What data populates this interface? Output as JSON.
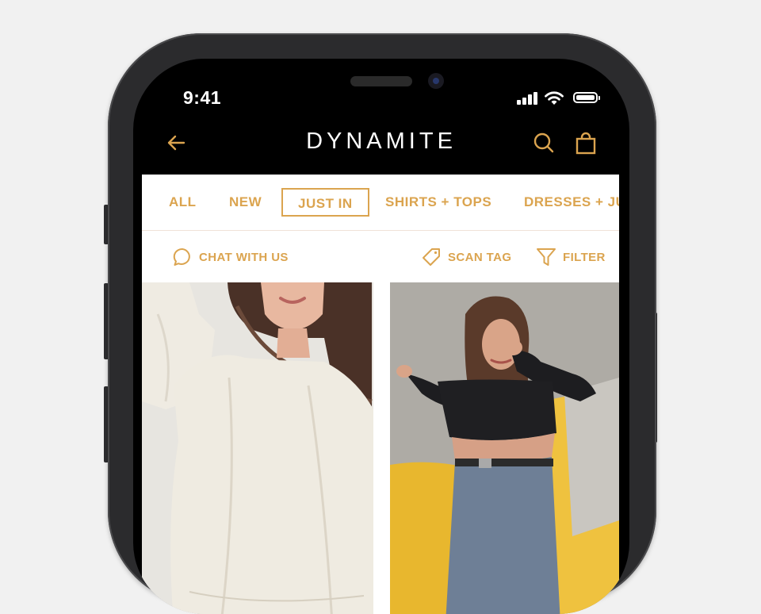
{
  "status_bar": {
    "time": "9:41"
  },
  "header": {
    "brand": "DYNAMITE",
    "back_icon": "arrow-left-icon",
    "search_icon": "search-icon",
    "bag_icon": "shopping-bag-icon"
  },
  "tabs": [
    {
      "label": "ALL",
      "active": false
    },
    {
      "label": "NEW",
      "active": false
    },
    {
      "label": "JUST IN",
      "active": true
    },
    {
      "label": "SHIRTS + TOPS",
      "active": false
    },
    {
      "label": "DRESSES + JU",
      "active": false
    }
  ],
  "toolbar": {
    "chat": {
      "label": "CHAT WITH US",
      "icon": "chat-bubble-icon"
    },
    "scan": {
      "label": "SCAN TAG",
      "icon": "tag-icon"
    },
    "filter": {
      "label": "FILTER",
      "icon": "filter-icon"
    }
  },
  "products": [
    {
      "image": "woman-in-cream-blouse"
    },
    {
      "image": "woman-in-black-crop-top-on-yellow-sofa"
    }
  ],
  "colors": {
    "accent": "#dba44f",
    "header_bg": "#000000",
    "content_bg": "#ffffff"
  }
}
